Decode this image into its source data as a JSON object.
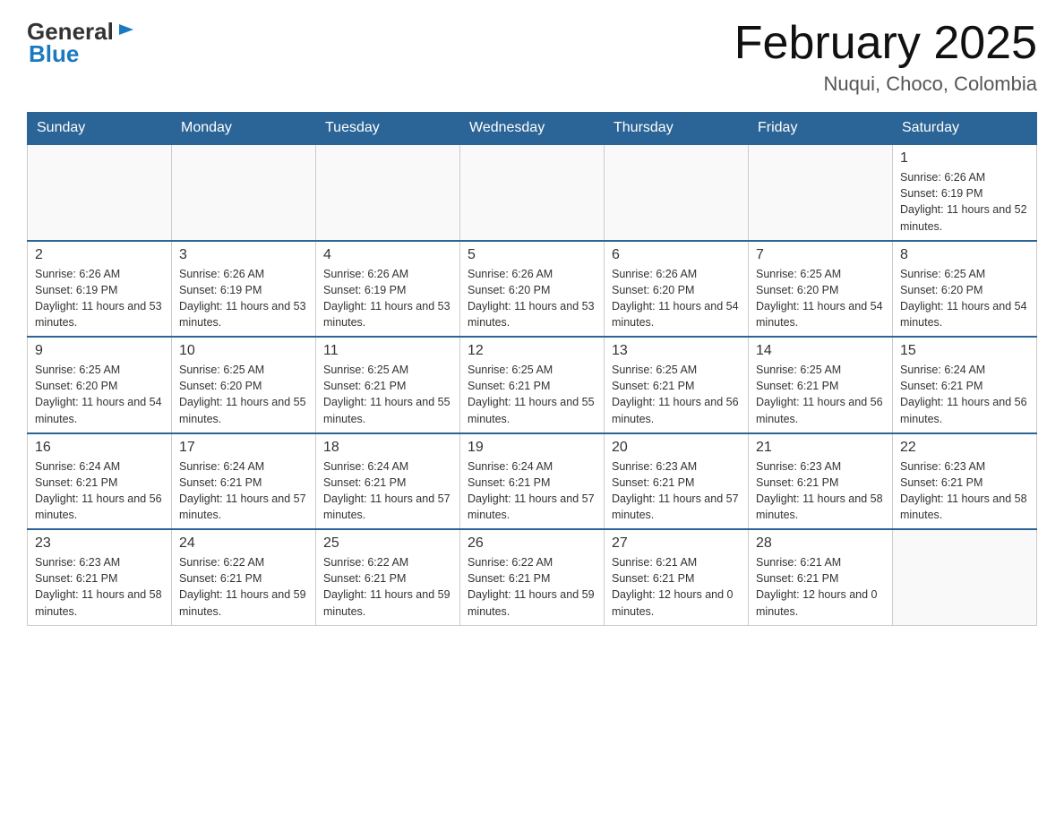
{
  "header": {
    "logo_general": "General",
    "logo_blue": "Blue",
    "month_title": "February 2025",
    "location": "Nuqui, Choco, Colombia"
  },
  "weekdays": [
    "Sunday",
    "Monday",
    "Tuesday",
    "Wednesday",
    "Thursday",
    "Friday",
    "Saturday"
  ],
  "weeks": [
    [
      {
        "day": null
      },
      {
        "day": null
      },
      {
        "day": null
      },
      {
        "day": null
      },
      {
        "day": null
      },
      {
        "day": null
      },
      {
        "day": "1",
        "sunrise": "6:26 AM",
        "sunset": "6:19 PM",
        "daylight": "11 hours and 52 minutes."
      }
    ],
    [
      {
        "day": "2",
        "sunrise": "6:26 AM",
        "sunset": "6:19 PM",
        "daylight": "11 hours and 53 minutes."
      },
      {
        "day": "3",
        "sunrise": "6:26 AM",
        "sunset": "6:19 PM",
        "daylight": "11 hours and 53 minutes."
      },
      {
        "day": "4",
        "sunrise": "6:26 AM",
        "sunset": "6:19 PM",
        "daylight": "11 hours and 53 minutes."
      },
      {
        "day": "5",
        "sunrise": "6:26 AM",
        "sunset": "6:20 PM",
        "daylight": "11 hours and 53 minutes."
      },
      {
        "day": "6",
        "sunrise": "6:26 AM",
        "sunset": "6:20 PM",
        "daylight": "11 hours and 54 minutes."
      },
      {
        "day": "7",
        "sunrise": "6:25 AM",
        "sunset": "6:20 PM",
        "daylight": "11 hours and 54 minutes."
      },
      {
        "day": "8",
        "sunrise": "6:25 AM",
        "sunset": "6:20 PM",
        "daylight": "11 hours and 54 minutes."
      }
    ],
    [
      {
        "day": "9",
        "sunrise": "6:25 AM",
        "sunset": "6:20 PM",
        "daylight": "11 hours and 54 minutes."
      },
      {
        "day": "10",
        "sunrise": "6:25 AM",
        "sunset": "6:20 PM",
        "daylight": "11 hours and 55 minutes."
      },
      {
        "day": "11",
        "sunrise": "6:25 AM",
        "sunset": "6:21 PM",
        "daylight": "11 hours and 55 minutes."
      },
      {
        "day": "12",
        "sunrise": "6:25 AM",
        "sunset": "6:21 PM",
        "daylight": "11 hours and 55 minutes."
      },
      {
        "day": "13",
        "sunrise": "6:25 AM",
        "sunset": "6:21 PM",
        "daylight": "11 hours and 56 minutes."
      },
      {
        "day": "14",
        "sunrise": "6:25 AM",
        "sunset": "6:21 PM",
        "daylight": "11 hours and 56 minutes."
      },
      {
        "day": "15",
        "sunrise": "6:24 AM",
        "sunset": "6:21 PM",
        "daylight": "11 hours and 56 minutes."
      }
    ],
    [
      {
        "day": "16",
        "sunrise": "6:24 AM",
        "sunset": "6:21 PM",
        "daylight": "11 hours and 56 minutes."
      },
      {
        "day": "17",
        "sunrise": "6:24 AM",
        "sunset": "6:21 PM",
        "daylight": "11 hours and 57 minutes."
      },
      {
        "day": "18",
        "sunrise": "6:24 AM",
        "sunset": "6:21 PM",
        "daylight": "11 hours and 57 minutes."
      },
      {
        "day": "19",
        "sunrise": "6:24 AM",
        "sunset": "6:21 PM",
        "daylight": "11 hours and 57 minutes."
      },
      {
        "day": "20",
        "sunrise": "6:23 AM",
        "sunset": "6:21 PM",
        "daylight": "11 hours and 57 minutes."
      },
      {
        "day": "21",
        "sunrise": "6:23 AM",
        "sunset": "6:21 PM",
        "daylight": "11 hours and 58 minutes."
      },
      {
        "day": "22",
        "sunrise": "6:23 AM",
        "sunset": "6:21 PM",
        "daylight": "11 hours and 58 minutes."
      }
    ],
    [
      {
        "day": "23",
        "sunrise": "6:23 AM",
        "sunset": "6:21 PM",
        "daylight": "11 hours and 58 minutes."
      },
      {
        "day": "24",
        "sunrise": "6:22 AM",
        "sunset": "6:21 PM",
        "daylight": "11 hours and 59 minutes."
      },
      {
        "day": "25",
        "sunrise": "6:22 AM",
        "sunset": "6:21 PM",
        "daylight": "11 hours and 59 minutes."
      },
      {
        "day": "26",
        "sunrise": "6:22 AM",
        "sunset": "6:21 PM",
        "daylight": "11 hours and 59 minutes."
      },
      {
        "day": "27",
        "sunrise": "6:21 AM",
        "sunset": "6:21 PM",
        "daylight": "12 hours and 0 minutes."
      },
      {
        "day": "28",
        "sunrise": "6:21 AM",
        "sunset": "6:21 PM",
        "daylight": "12 hours and 0 minutes."
      },
      {
        "day": null
      }
    ]
  ],
  "labels": {
    "sunrise": "Sunrise:",
    "sunset": "Sunset:",
    "daylight": "Daylight:"
  }
}
